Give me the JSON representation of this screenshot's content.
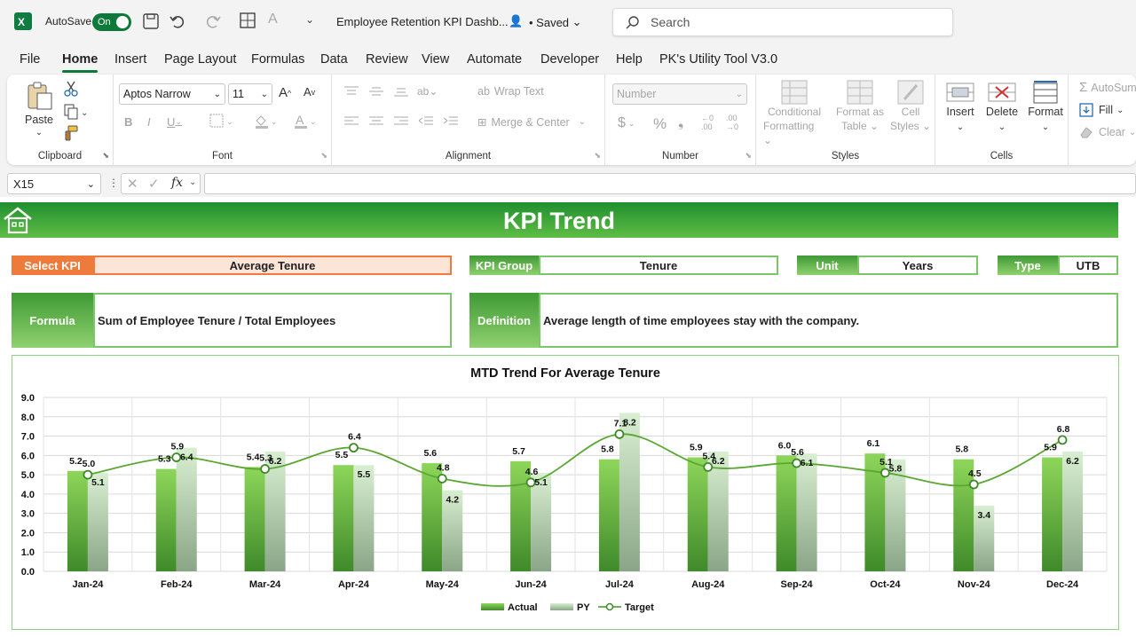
{
  "app": {
    "autosave_label": "AutoSave",
    "autosave_state": "On",
    "doc_title": "Employee Retention KPI Dashb...",
    "save_status": "• Saved",
    "search_placeholder": "Search"
  },
  "menu": [
    "File",
    "Home",
    "Insert",
    "Page Layout",
    "Formulas",
    "Data",
    "Review",
    "View",
    "Automate",
    "Developer",
    "Help",
    "PK's Utility Tool V3.0"
  ],
  "ribbon": {
    "clipboard": {
      "label": "Clipboard",
      "paste": "Paste"
    },
    "font": {
      "label": "Font",
      "name": "Aptos Narrow",
      "size": "11"
    },
    "alignment": {
      "label": "Alignment",
      "wrap": "Wrap Text",
      "merge": "Merge & Center"
    },
    "number": {
      "label": "Number",
      "format": "Number"
    },
    "styles": {
      "label": "Styles",
      "cond1": "Conditional",
      "cond2": "Formatting",
      "fmt1": "Format as",
      "fmt2": "Table",
      "cell1": "Cell",
      "cell2": "Styles"
    },
    "cells": {
      "label": "Cells",
      "insert": "Insert",
      "delete": "Delete",
      "format": "Format"
    },
    "editing": {
      "autosum": "AutoSum",
      "fill": "Fill",
      "clear": "Clear"
    }
  },
  "formula_bar": {
    "name_box": "X15",
    "fx": "fx"
  },
  "sheet": {
    "title": "KPI Trend",
    "select_kpi_label": "Select KPI",
    "select_kpi_value": "Average Tenure",
    "kpi_group_label": "KPI Group",
    "kpi_group_value": "Tenure",
    "unit_label": "Unit",
    "unit_value": "Years",
    "type_label": "Type",
    "type_value": "UTB",
    "formula_label": "Formula",
    "formula_value": "Sum of Employee Tenure / Total Employees",
    "definition_label": "Definition",
    "definition_value": "Average length of time employees stay with the company."
  },
  "colors": {
    "accent_green": "#0e7a3a",
    "banner_green": "#3fa83a",
    "select_orange": "#ee7a3c",
    "target_line": "#5aa832"
  },
  "chart_data": {
    "type": "bar",
    "title": "MTD Trend For Average Tenure",
    "categories": [
      "Jan-24",
      "Feb-24",
      "Mar-24",
      "Apr-24",
      "May-24",
      "Jun-24",
      "Jul-24",
      "Aug-24",
      "Sep-24",
      "Oct-24",
      "Nov-24",
      "Dec-24"
    ],
    "series": [
      {
        "name": "Actual",
        "type": "bar",
        "values": [
          5.2,
          5.3,
          5.4,
          5.5,
          5.6,
          5.7,
          5.8,
          5.9,
          6.0,
          6.1,
          5.8,
          5.9
        ]
      },
      {
        "name": "PY",
        "type": "bar",
        "values": [
          5.1,
          6.4,
          6.2,
          5.5,
          4.2,
          5.1,
          8.2,
          6.2,
          6.1,
          5.8,
          3.4,
          6.2
        ]
      },
      {
        "name": "Target",
        "type": "line",
        "values": [
          5.0,
          5.9,
          5.3,
          6.4,
          4.8,
          4.6,
          7.1,
          5.4,
          5.6,
          5.1,
          4.5,
          6.8
        ]
      }
    ],
    "y_ticks": [
      "0.0",
      "1.0",
      "2.0",
      "3.0",
      "4.0",
      "5.0",
      "6.0",
      "7.0",
      "8.0",
      "9.0"
    ],
    "ylim": [
      0,
      9
    ],
    "grid": true,
    "legend": "bottom"
  }
}
